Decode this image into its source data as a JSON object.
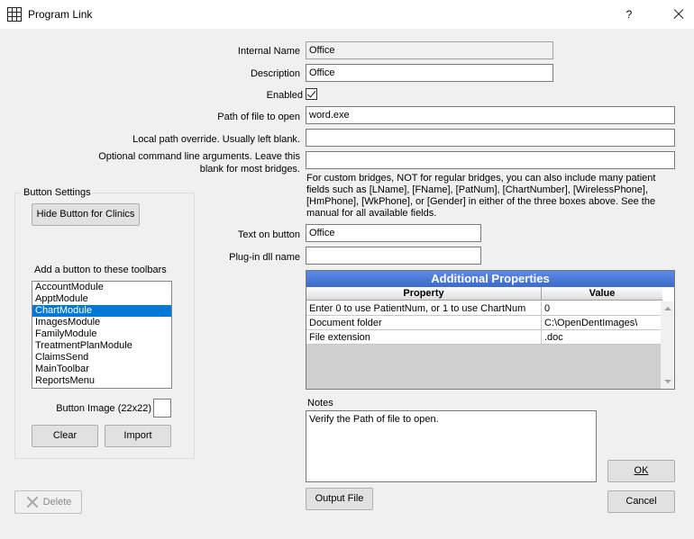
{
  "window": {
    "title": "Program Link",
    "help_label": "?"
  },
  "form": {
    "internal_name_label": "Internal Name",
    "internal_name_value": "Office",
    "description_label": "Description",
    "description_value": "Office",
    "enabled_label": "Enabled",
    "enabled_checked": true,
    "path_label": "Path of file to open",
    "path_value": "word.exe",
    "local_override_label": "Local path override.  Usually left blank.",
    "local_override_value": "",
    "cmdline_label_1": "Optional command line arguments.  Leave this",
    "cmdline_label_2": "blank for most bridges.",
    "cmdline_value": "",
    "info_text": "For custom bridges, NOT for regular bridges, you can also include many patient fields such as [LName], [FName], [PatNum], [ChartNumber], [WirelessPhone], [HmPhone], [WkPhone], or [Gender] in either of the three boxes above. See the manual for all available fields.",
    "button_text_label": "Text on button",
    "button_text_value": "Office",
    "plugin_label": "Plug-in dll name",
    "plugin_value": ""
  },
  "button_settings": {
    "group_title": "Button Settings",
    "hide_button_label": "Hide Button for Clinics",
    "toolbars_label": "Add a button to these toolbars",
    "toolbars": [
      "AccountModule",
      "ApptModule",
      "ChartModule",
      "ImagesModule",
      "FamilyModule",
      "TreatmentPlanModule",
      "ClaimsSend",
      "MainToolbar",
      "ReportsMenu"
    ],
    "selected_toolbar": "ChartModule",
    "button_image_label": "Button Image (22x22)",
    "clear_label": "Clear",
    "import_label": "Import"
  },
  "properties": {
    "title": "Additional Properties",
    "columns": [
      "Property",
      "Value"
    ],
    "rows": [
      [
        "Enter 0 to use PatientNum, or 1 to use ChartNum",
        "0"
      ],
      [
        "Document folder",
        "C:\\OpenDentImages\\"
      ],
      [
        "File extension",
        ".doc"
      ]
    ]
  },
  "notes": {
    "label": "Notes",
    "value": "Verify the Path of file to open."
  },
  "buttons": {
    "delete_label": "Delete",
    "output_file_label": "Output File",
    "ok_label": "OK",
    "cancel_label": "Cancel"
  }
}
